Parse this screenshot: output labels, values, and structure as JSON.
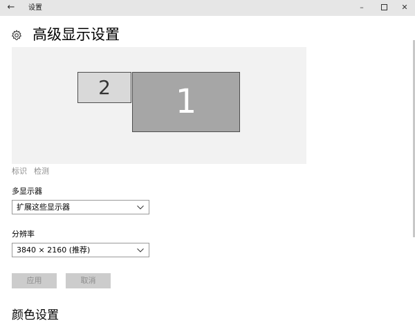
{
  "window": {
    "back_glyph": "←",
    "title": "设置",
    "minimize_glyph": "–",
    "close_glyph": "✕"
  },
  "page": {
    "title": "高级显示设置"
  },
  "display_arrangement": {
    "monitors": [
      {
        "label": "2"
      },
      {
        "label": "1"
      }
    ],
    "identify_label": "标识",
    "detect_label": "检测"
  },
  "multi_display": {
    "label": "多显示器",
    "selected": "扩展这些显示器"
  },
  "resolution": {
    "label": "分辨率",
    "selected": "3840 × 2160 (推荐)"
  },
  "buttons": {
    "apply": "应用",
    "cancel": "取消"
  },
  "sections": {
    "color_settings": "颜色设置"
  }
}
